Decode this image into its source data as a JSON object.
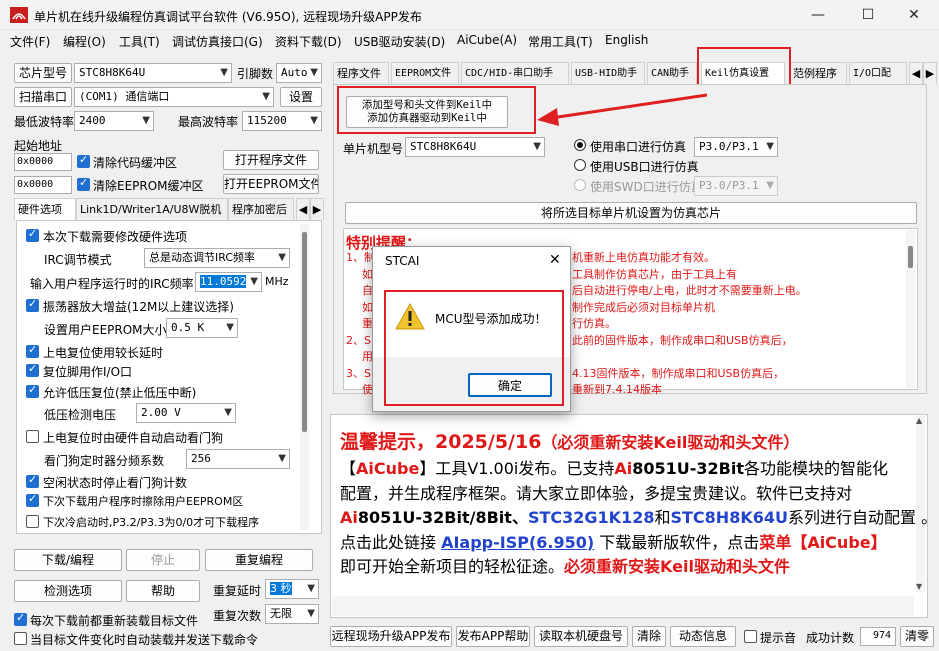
{
  "window": {
    "title": "单片机在线升级编程仿真调试平台软件 (V6.95O), 远程现场升级APP发布",
    "minimize": "—",
    "maximize": "☐",
    "close": "✕"
  },
  "menu": [
    "文件(F)",
    "编程(O)",
    "工具(T)",
    "调试仿真接口(G)",
    "资料下载(D)",
    "USB驱动安装(D)",
    "AiCube(A)",
    "常用工具(T)",
    "English"
  ],
  "left": {
    "chip_label": "芯片型号",
    "chip_value": "STC8H8K64U",
    "pins_label": "引脚数",
    "pins_value": "Auto",
    "scan_button": "扫描串口",
    "port_value": "(COM1) 通信端口",
    "settings_button": "设置",
    "min_baud_label": "最低波特率",
    "min_baud_value": "2400",
    "max_baud_label": "最高波特率",
    "max_baud_value": "115200",
    "start_addr_label": "起始地址",
    "code_addr": "0x0000",
    "clear_code_label": "清除代码缓冲区",
    "open_program_button": "打开程序文件",
    "eeprom_addr": "0x0000",
    "clear_eeprom_label": "清除EEPROM缓冲区",
    "open_eeprom_button": "打开EEPROM文件",
    "subtabs": [
      "硬件选项",
      "Link1D/Writer1A/U8W脱机",
      "程序加密后"
    ],
    "hw": {
      "need_modify": "本次下载需要修改硬件选项",
      "irc_mode_label": "IRC调节模式",
      "irc_mode_value": "总是动态调节IRC频率",
      "irc_freq_label": "输入用户程序运行时的IRC频率",
      "irc_freq_value": "11.0592",
      "irc_unit": "MHz",
      "osc_gain": "振荡器放大增益(12M以上建议选择)",
      "eeprom_size_label": "设置用户EEPROM大小",
      "eeprom_size_value": "0.5 K",
      "long_reset": "上电复位使用较长延时",
      "reset_pin": "复位脚用作I/O口",
      "lvd_reset": "允许低压复位(禁止低压中断)",
      "lvd_voltage_label": "低压检测电压",
      "lvd_voltage_value": "2.00 V",
      "wdt_auto": "上电复位时由硬件自动启动看门狗",
      "wdt_div_label": "看门狗定时器分频系数",
      "wdt_div_value": "256",
      "idle_wdt": "空闲状态时停止看门狗计数",
      "erase_eeprom": "下次下载用户程序时擦除用户EEPROM区",
      "cold_boot": "下次冷启动时,P3.2/P3.3为0/0才可下载程序"
    },
    "download_button": "下载/编程",
    "stop_button": "停止",
    "reprogram_button": "重复编程",
    "detect_button": "检测选项",
    "help_button": "帮助",
    "repeat_delay_label": "重复延时",
    "repeat_delay_value": "3 秒",
    "repeat_count_label": "重复次数",
    "repeat_count_value": "无限",
    "reload_label": "每次下载前都重新装载目标文件",
    "auto_reload_label": "当目标文件变化时自动装载并发送下载命令"
  },
  "right": {
    "tabs": [
      "程序文件",
      "EEPROM文件",
      "CDC/HID-串口助手",
      "USB-HID助手",
      "CAN助手",
      "Keil仿真设置",
      "范例程序",
      "I/O口配"
    ],
    "add_button_line1": "添加型号和头文件到Keil中",
    "add_button_line2": "添加仿真器驱动到Keil中",
    "mcu_label": "单片机型号",
    "mcu_value": "STC8H8K64U",
    "radio_serial": "使用串口进行仿真",
    "serial_port_value": "P3.0/P3.1",
    "radio_usb": "使用USB口进行仿真",
    "radio_swd": "使用SWD口进行仿真",
    "swd_port_value": "P3.0/P3.1",
    "set_chip_button": "将所选目标单片机设置为仿真芯片",
    "notice_title": "特别提醒：",
    "notice_lines": [
      "1、制",
      "机重新上电仿真功能才有效。",
      "如",
      "工具制作仿真芯片，由于工具上有",
      "自",
      "后自动进行停电/上电，此时才不需要重新上电。",
      "如",
      "制作完成后必须对目标单片机",
      "重",
      "行仿真。",
      "2、S",
      "此前的固件版本，制作成串口和USB仿真后，",
      "用",
      "3、S",
      "4.13固件版本，制作成串口和USB仿真后，",
      "使",
      "重新到7.4.14版本"
    ],
    "news": {
      "headline_a": "温馨提示，2025/5/16",
      "headline_b": "（必须重新安装Keil驱动和头文件）",
      "l2_a": "【",
      "l2_b": "AiCube",
      "l2_c": "】工具V1.00i发布。已支持",
      "l2_d": "Ai",
      "l2_e": "8051U-32Bit",
      "l2_f": "各功能模块的智能化",
      "l3": "配置，并生成程序框架。请大家立即体验，多提宝贵建议。软件已支持对",
      "l4_a": "Ai",
      "l4_b": "8051U-32Bit/8Bit、",
      "l4_c": "STC32G1K128",
      "l4_d": "和",
      "l4_e": "STC8H8K64U",
      "l4_f": "系列进行自动配置 。",
      "l5_a": "点击此处链接 ",
      "l5_b": "AIapp-ISP(6.950)",
      "l5_c": " 下载最新版软件，点击",
      "l5_d": "菜单【AiCube】",
      "l6_a": "即可开始全新项目的轻松征途。",
      "l6_b": "必须重新安装Keil驱动和头文件"
    },
    "bottom": {
      "publish_button": "远程现场升级APP发布",
      "help_button": "发布APP帮助",
      "read_disk_button": "读取本机硬盘号",
      "clear_button": "清除",
      "anim_button": "动态信息",
      "beep_label": "提示音",
      "count_label": "成功计数",
      "count_value": "974",
      "zero_button": "清零"
    }
  },
  "dialog": {
    "title": "STCAI",
    "message": "MCU型号添加成功！",
    "ok_button": "确定",
    "close": "✕"
  },
  "colors": {
    "annotation": "#e02020",
    "notice": "#e01818",
    "link": "#2244cc",
    "checked": "#1f6fd0"
  }
}
